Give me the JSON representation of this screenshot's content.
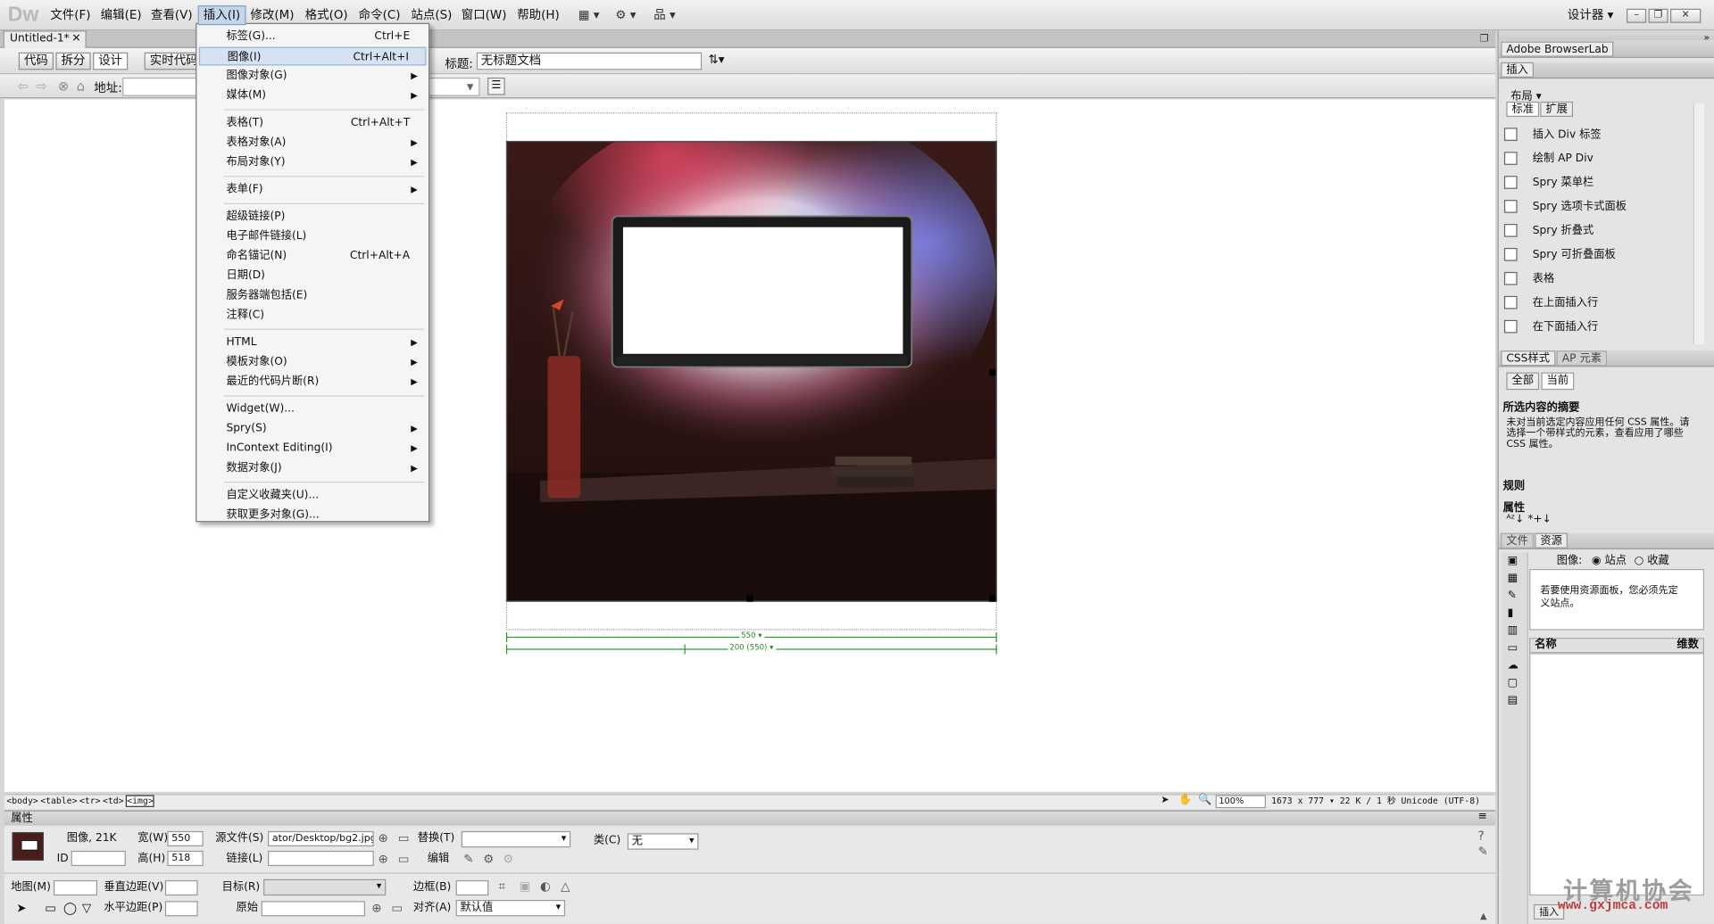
{
  "app": {
    "logo": "Dw",
    "workspace": "设计器"
  },
  "menus": [
    "文件(F)",
    "编辑(E)",
    "查看(V)",
    "插入(I)",
    "修改(M)",
    "格式(O)",
    "命令(C)",
    "站点(S)",
    "窗口(W)",
    "帮助(H)"
  ],
  "doc": {
    "tab": "Untitled-1*",
    "title_label": "标题:",
    "title": "无标题文档",
    "address_label": "地址:",
    "views": [
      "代码",
      "拆分",
      "设计",
      "实时代码"
    ]
  },
  "insert_menu": [
    {
      "label": "标签(G)...",
      "shortcut": "Ctrl+E"
    },
    {
      "label": "图像(I)",
      "shortcut": "Ctrl+Alt+I",
      "highlight": true
    },
    {
      "label": "图像对象(G)",
      "sub": true
    },
    {
      "label": "媒体(M)",
      "sub": true
    },
    {
      "sep": true
    },
    {
      "label": "表格(T)",
      "shortcut": "Ctrl+Alt+T"
    },
    {
      "label": "表格对象(A)",
      "sub": true
    },
    {
      "label": "布局对象(Y)",
      "sub": true
    },
    {
      "sep": true
    },
    {
      "label": "表单(F)",
      "sub": true
    },
    {
      "sep": true
    },
    {
      "label": "超级链接(P)"
    },
    {
      "label": "电子邮件链接(L)"
    },
    {
      "label": "命名锚记(N)",
      "shortcut": "Ctrl+Alt+A"
    },
    {
      "label": "日期(D)"
    },
    {
      "label": "服务器端包括(E)"
    },
    {
      "label": "注释(C)"
    },
    {
      "sep": true
    },
    {
      "label": "HTML",
      "sub": true
    },
    {
      "label": "模板对象(O)",
      "sub": true
    },
    {
      "label": "最近的代码片断(R)",
      "sub": true
    },
    {
      "sep": true
    },
    {
      "label": "Widget(W)..."
    },
    {
      "label": "Spry(S)",
      "sub": true
    },
    {
      "label": "InContext Editing(I)",
      "sub": true
    },
    {
      "label": "数据对象(J)",
      "sub": true
    },
    {
      "sep": true
    },
    {
      "label": "自定义收藏夹(U)..."
    },
    {
      "label": "获取更多对象(G)..."
    }
  ],
  "canvas": {
    "ruler_outer": "550 ▾",
    "ruler_inner": "200 (550) ▾"
  },
  "status": {
    "tags": [
      "<body>",
      "<table>",
      "<tr>",
      "<td>",
      "<img>"
    ],
    "zoom": "100%",
    "info": "1673 x 777 ▾ 22 K / 1 秒 Unicode (UTF-8)"
  },
  "props": {
    "header": "属性",
    "type": "图像, 21K",
    "id_label": "ID",
    "w_label": "宽(W)",
    "w": "550",
    "h_label": "高(H)",
    "h": "518",
    "src_label": "源文件(S)",
    "src": "ator/Desktop/bg2.jpg",
    "link_label": "链接(L)",
    "alt_label": "替换(T)",
    "edit_label": "编辑",
    "class_label": "类(C)",
    "class_val": "无",
    "map_label": "地图(M)",
    "vspace_label": "垂直边距(V)",
    "hspace_label": "水平边距(P)",
    "target_label": "目标(R)",
    "orig_label": "原始",
    "border_label": "边框(B)",
    "align_label": "对齐(A)",
    "align_val": "默认值"
  },
  "panel": {
    "browserlab": "Adobe BrowserLab",
    "insert": "插入",
    "layout": "布局 ▾",
    "tab_std": "标准",
    "tab_ext": "扩展",
    "insert_items": [
      "插入 Div 标签",
      "绘制 AP Div",
      "Spry 菜单栏",
      "Spry 选项卡式面板",
      "Spry 折叠式",
      "Spry 可折叠面板",
      "表格",
      "在上面插入行",
      "在下面插入行"
    ],
    "css_tab": "CSS样式",
    "ap_tab": "AP 元素",
    "all": "全部",
    "current": "当前",
    "summary_title": "所选内容的摘要",
    "summary_text": "未对当前选定内容应用任何 CSS 属性。请选择一个带样式的元素，查看应用了哪些 CSS 属性。",
    "rules": "规则",
    "properties": "属性",
    "files_tab": "文件",
    "assets_tab": "资源",
    "images_label": "图像:",
    "site": "站点",
    "favorites": "收藏",
    "assets_msg": "若要使用资源面板，您必须先定义站点。",
    "col_name": "名称",
    "col_dim": "维数",
    "insert_btn": "插入"
  },
  "watermark": {
    "title": "计算机协会",
    "url": "www.gxjmca.com"
  }
}
